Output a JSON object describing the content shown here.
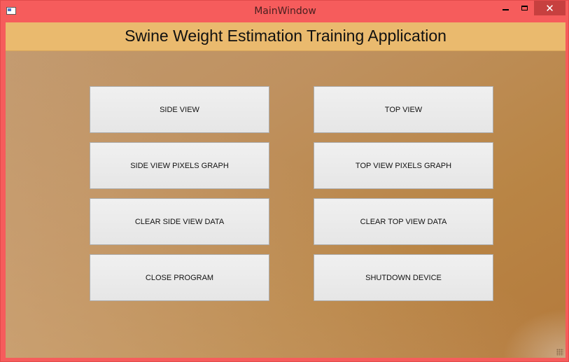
{
  "window": {
    "title": "MainWindow",
    "close_glyph": "✕",
    "frame_color": "#f65c5c",
    "close_color": "#c7403f"
  },
  "banner": {
    "title": "Swine Weight Estimation Training Application",
    "color": "#eaba6e"
  },
  "buttons": {
    "side_view": "SIDE VIEW",
    "top_view": "TOP VIEW",
    "side_view_pixels_graph": "SIDE VIEW PIXELS GRAPH",
    "top_view_pixels_graph": "TOP VIEW PIXELS GRAPH",
    "clear_side_view_data": "CLEAR SIDE VIEW DATA",
    "clear_top_view_data": "CLEAR TOP VIEW DATA",
    "close_program": "CLOSE PROGRAM",
    "shutdown_device": "SHUTDOWN DEVICE"
  },
  "icons": {
    "app": "app-window-icon",
    "minimize": "minimize-icon",
    "maximize": "maximize-icon",
    "close": "close-icon",
    "resize": "resize-grip-icon"
  }
}
